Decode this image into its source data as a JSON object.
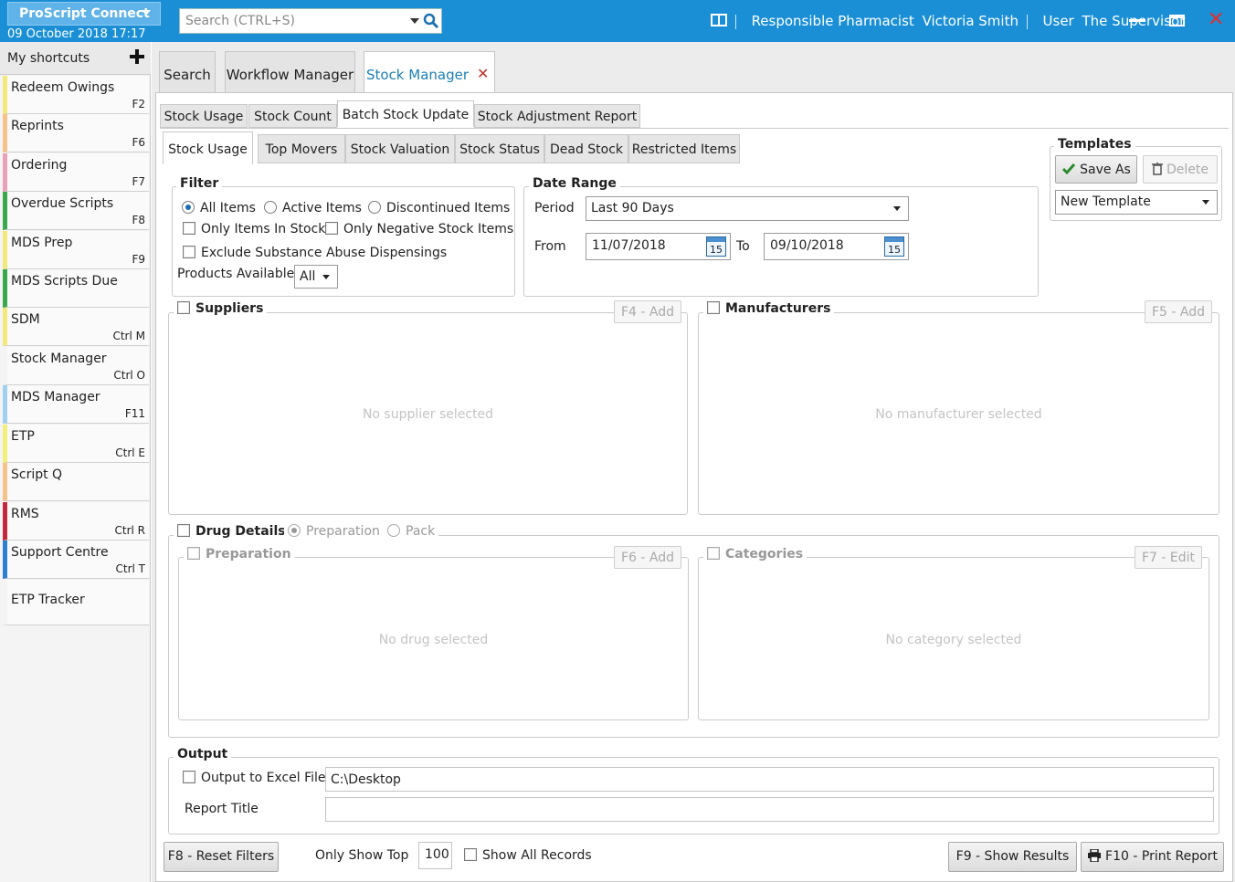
{
  "app": {
    "brand": "ProScript Connect",
    "datetime": "09 October 2018 17:17",
    "search_placeholder": "Search (CTRL+S)",
    "pharmacist_label": "Responsible Pharmacist",
    "pharmacist_name": "Victoria Smith",
    "user_label": "User",
    "user_name": "The Supervisor"
  },
  "sidebar": {
    "title": "My shortcuts",
    "items": [
      {
        "label": "Redeem Owings",
        "key": "F2",
        "color": "#f3e97a"
      },
      {
        "label": "Reprints",
        "key": "F6",
        "color": "#f6c18a"
      },
      {
        "label": "Ordering",
        "key": "F7",
        "color": "#e9a0b8"
      },
      {
        "label": "Overdue Scripts",
        "key": "F8",
        "color": "#3aa84c"
      },
      {
        "label": "MDS Prep",
        "key": "F9",
        "color": "#f3e97a"
      },
      {
        "label": "MDS Scripts Due",
        "key": "",
        "color": "#3aa84c"
      },
      {
        "label": "SDM",
        "key": "Ctrl M",
        "color": "#f3e97a"
      },
      {
        "label": "Stock Manager",
        "key": "Ctrl O",
        "color": "#f4f4f4"
      },
      {
        "label": "MDS Manager",
        "key": "F11",
        "color": "#9fd0ef"
      },
      {
        "label": "ETP",
        "key": "Ctrl E",
        "color": "#f3f07a"
      },
      {
        "label": "Script Q",
        "key": "",
        "color": "#f6c18a"
      },
      {
        "label": "RMS",
        "key": "Ctrl R",
        "color": "#c12a3a"
      },
      {
        "label": "Support Centre",
        "key": "Ctrl T",
        "color": "#2f7fd0"
      },
      {
        "label": "ETP Tracker",
        "key": "",
        "color": "#f4f4f4"
      }
    ]
  },
  "top_tabs": [
    "Search",
    "Workflow Manager",
    "Stock Manager"
  ],
  "second_tabs": [
    "Stock Usage",
    "Stock Count",
    "Batch Stock Update",
    "Stock Adjustment Report"
  ],
  "third_tabs": [
    "Stock Usage",
    "Top Movers",
    "Stock Valuation",
    "Stock Status",
    "Dead Stock",
    "Restricted Items"
  ],
  "filter": {
    "title": "Filter",
    "all_items": "All Items",
    "active_items": "Active Items",
    "discontinued_items": "Discontinued Items",
    "only_in_stock": "Only Items In Stock",
    "only_negative": "Only Negative Stock Items",
    "exclude_substance": "Exclude Substance Abuse Dispensings",
    "products_available": "Products Available",
    "products_value": "All"
  },
  "date_range": {
    "title": "Date Range",
    "period_label": "Period",
    "period_value": "Last 90 Days",
    "from_label": "From",
    "from_value": "11/07/2018",
    "to_label": "To",
    "to_value": "09/10/2018",
    "cal_day": "15"
  },
  "templates": {
    "title": "Templates",
    "save_as": "Save As",
    "delete": "Delete",
    "current": "New Template"
  },
  "suppliers": {
    "title": "Suppliers",
    "add": "F4 - Add",
    "empty": "No supplier selected"
  },
  "manufacturers": {
    "title": "Manufacturers",
    "add": "F5 - Add",
    "empty": "No manufacturer selected"
  },
  "drug_details": {
    "title": "Drug Details",
    "preparation_opt": "Preparation",
    "pack_opt": "Pack",
    "preparation": {
      "title": "Preparation",
      "add": "F6 - Add",
      "empty": "No drug selected"
    },
    "categories": {
      "title": "Categories",
      "edit": "F7 - Edit",
      "empty": "No category selected"
    }
  },
  "output": {
    "title": "Output",
    "excel_label": "Output to Excel File",
    "excel_path": "C:\\Desktop",
    "report_title_label": "Report Title",
    "report_title_value": ""
  },
  "footer": {
    "reset": "F8 - Reset Filters",
    "only_show_top": "Only Show Top",
    "top_value": "100",
    "show_all": "Show All Records",
    "show_results": "F9 - Show Results",
    "print_report": "F10 - Print Report"
  }
}
